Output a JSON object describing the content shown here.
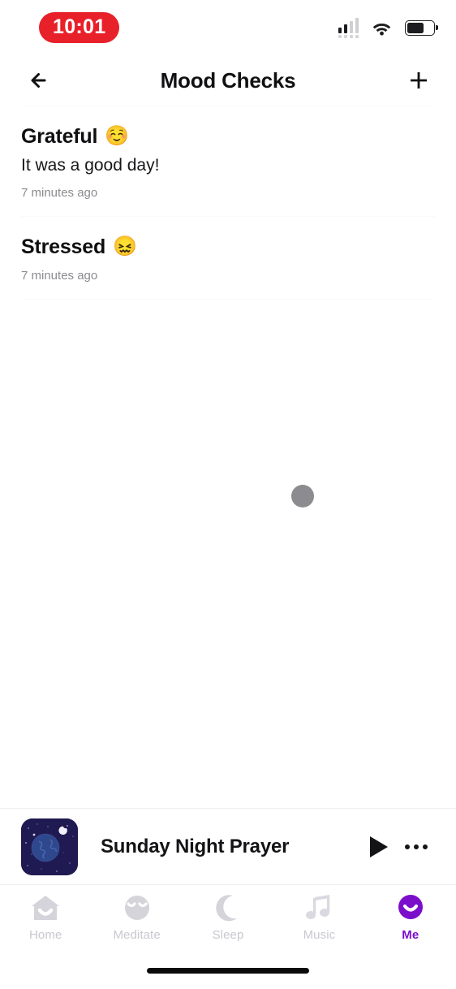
{
  "status_bar": {
    "time": "10:01",
    "time_badge_color": "#e8202a",
    "icons": [
      "cellular-signal-icon",
      "wifi-icon",
      "battery-icon"
    ],
    "battery_level_percent": 64
  },
  "header": {
    "back_icon": "arrow-left-icon",
    "title": "Mood Checks",
    "add_icon": "plus-icon"
  },
  "main": {
    "mood_checks": [
      {
        "mood": "Grateful",
        "emoji": "☺️",
        "emoji_name": "relieved-face-emoji",
        "note": "It was a good day!",
        "timestamp": "7 minutes ago"
      },
      {
        "mood": "Stressed",
        "emoji": "😖",
        "emoji_name": "confounded-face-emoji",
        "note": "",
        "timestamp": "7 minutes ago"
      }
    ],
    "loading_indicator": "loading-dot"
  },
  "player": {
    "artwork_name": "night-sky-planet-artwork",
    "artwork_bg_color": "#201a52",
    "track_title": "Sunday Night Prayer",
    "play_icon": "play-icon",
    "more_icon": "more-horizontal-icon"
  },
  "tabbar": {
    "active_color": "#7b0ecb",
    "inactive_color": "#c8c8cf",
    "items": [
      {
        "label": "Home",
        "icon": "home-smile-icon",
        "active": false
      },
      {
        "label": "Meditate",
        "icon": "meditating-face-icon",
        "active": false
      },
      {
        "label": "Sleep",
        "icon": "crescent-moon-icon",
        "active": false
      },
      {
        "label": "Music",
        "icon": "music-note-icon",
        "active": false
      },
      {
        "label": "Me",
        "icon": "profile-smile-icon",
        "active": true
      }
    ]
  }
}
